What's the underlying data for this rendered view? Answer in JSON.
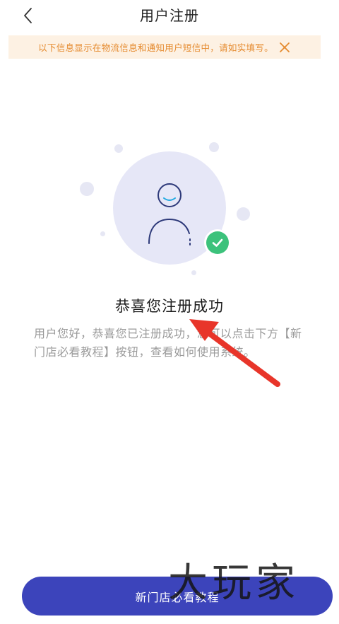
{
  "nav": {
    "title": "用户注册"
  },
  "notice": {
    "text": "以下信息显示在物流信息和通知用户短信中，请如实填写。"
  },
  "success": {
    "title": "恭喜您注册成功",
    "description": "用户您好，恭喜您已注册成功，您可以点击下方【新门店必看教程】按钮，查看如何使用系统。"
  },
  "button": {
    "label": "新门店必看教程"
  },
  "watermark": {
    "text": "大玩家"
  },
  "icons": {
    "back": "chevron-left-icon",
    "close": "close-icon",
    "user": "user-icon",
    "check": "check-icon"
  },
  "colors": {
    "notice_bg": "#fdf1e3",
    "notice_text": "#e58a2e",
    "primary": "#3c44bb",
    "success": "#3cc27b",
    "arrow": "#e8352a",
    "illustration_bg": "#e6e7f7"
  }
}
